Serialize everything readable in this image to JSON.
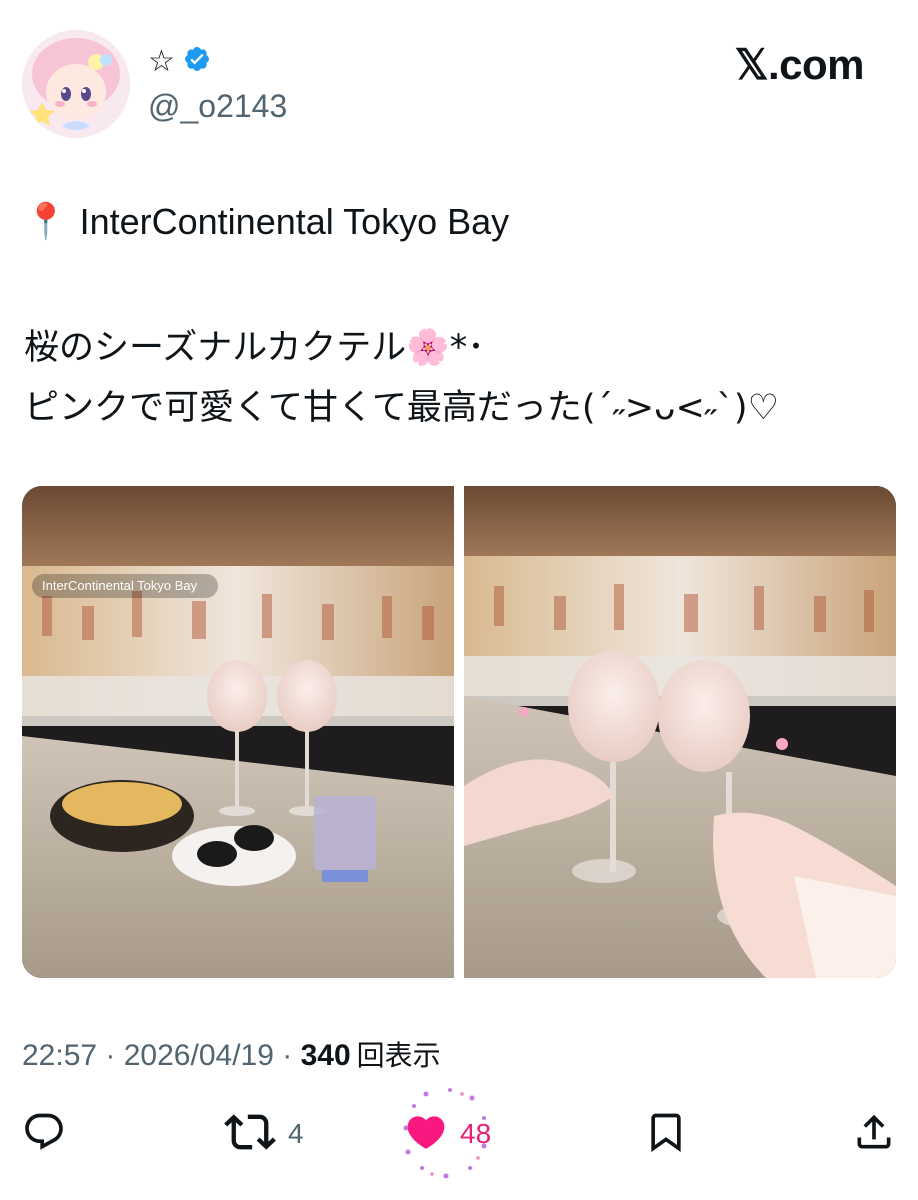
{
  "user": {
    "display_name": "☆",
    "handle": "@_o2143",
    "verified": true
  },
  "brand": {
    "logo_text": "𝕏.com"
  },
  "post": {
    "location_icon": "📍",
    "location": "InterContinental Tokyo Bay",
    "line1": "桜のシーズナルカクテル",
    "line1_emoji": "🌸",
    "line1_suffix": "*･",
    "line2": "ピンクで可愛くて甘くて最高だった(ˊ˶>ᴗ<˶ˋ)♡"
  },
  "photos": [
    {
      "overlay_label": "InterContinental Tokyo Bay",
      "icon": "cocktail-photo"
    },
    {
      "icon": "toast-photo"
    }
  ],
  "meta": {
    "time": "22:57",
    "separator": " · ",
    "date": "2026/04/19",
    "views_count": "340",
    "views_label": "回表示"
  },
  "actions": {
    "reply_icon": "reply-icon",
    "retweet_icon": "retweet-icon",
    "retweet_count": "4",
    "like_icon": "heart-icon",
    "like_count": "48",
    "bookmark_icon": "bookmark-icon",
    "share_icon": "share-icon"
  },
  "colors": {
    "text": "#0f1419",
    "secondary": "#536471",
    "verified": "#1d9bf0",
    "like": "#e8207a"
  }
}
